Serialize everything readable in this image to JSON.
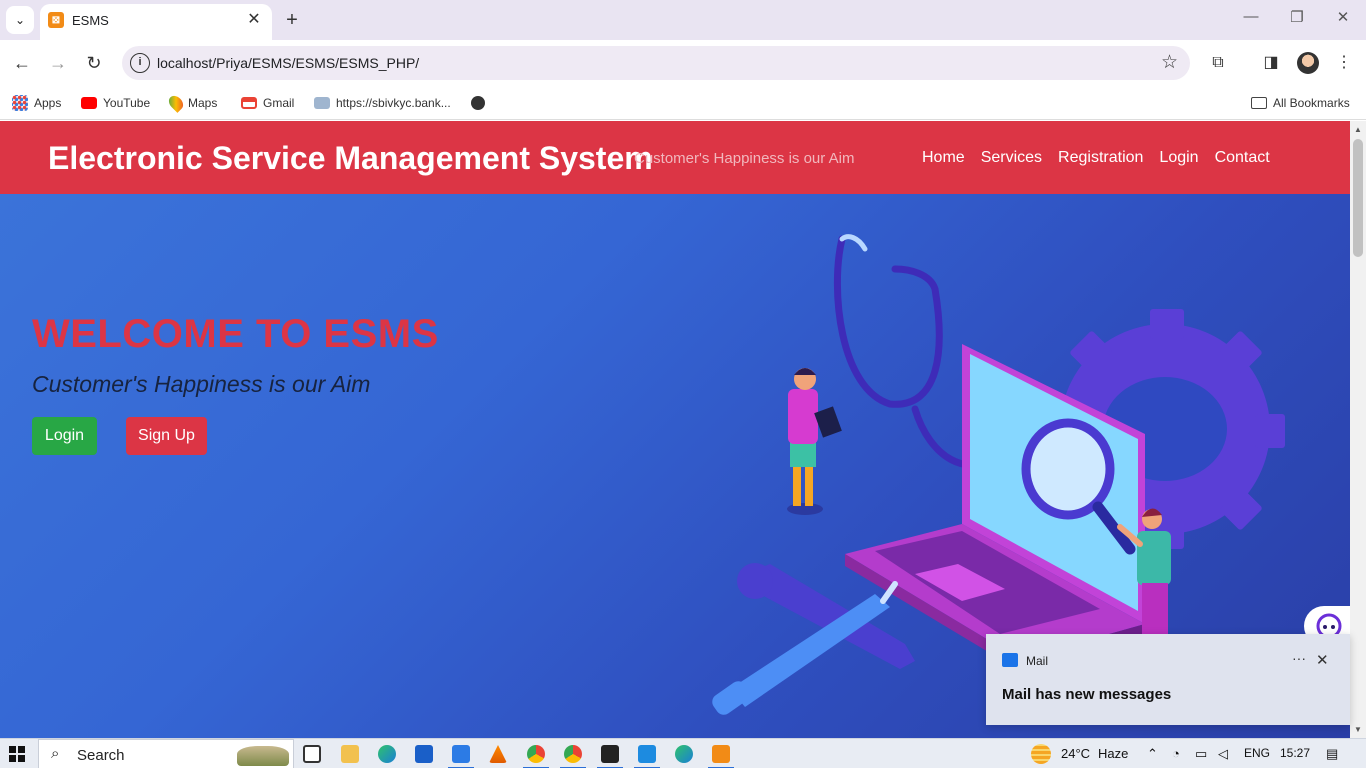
{
  "browser": {
    "tab_title": "ESMS",
    "url": "localhost/Priya/ESMS/ESMS/ESMS_PHP/",
    "bookmarks": [
      "Apps",
      "YouTube",
      "Maps",
      "Gmail",
      "https://sbivkyc.bank..."
    ],
    "all_bookmarks": "All Bookmarks"
  },
  "site": {
    "brand": "Electronic Service Management System",
    "tagline": "Customer's Happiness is our Aim",
    "nav": [
      "Home",
      "Services",
      "Registration",
      "Login",
      "Contact"
    ]
  },
  "hero": {
    "title": "WELCOME TO ESMS",
    "subtitle": "Customer's Happiness is our Aim",
    "login_label": "Login",
    "signup_label": "Sign Up"
  },
  "notification": {
    "app": "Mail",
    "message": "Mail has new messages"
  },
  "taskbar": {
    "search_label": "Search",
    "weather": "24°C",
    "weather_desc": "Haze",
    "language": "ENG",
    "time": "15:27"
  },
  "colors": {
    "navbar": "#dc3545",
    "hero_start": "#3b73d9",
    "hero_end": "#2a3ea6",
    "login_button": "#28a745",
    "signup_button": "#dc3545"
  }
}
